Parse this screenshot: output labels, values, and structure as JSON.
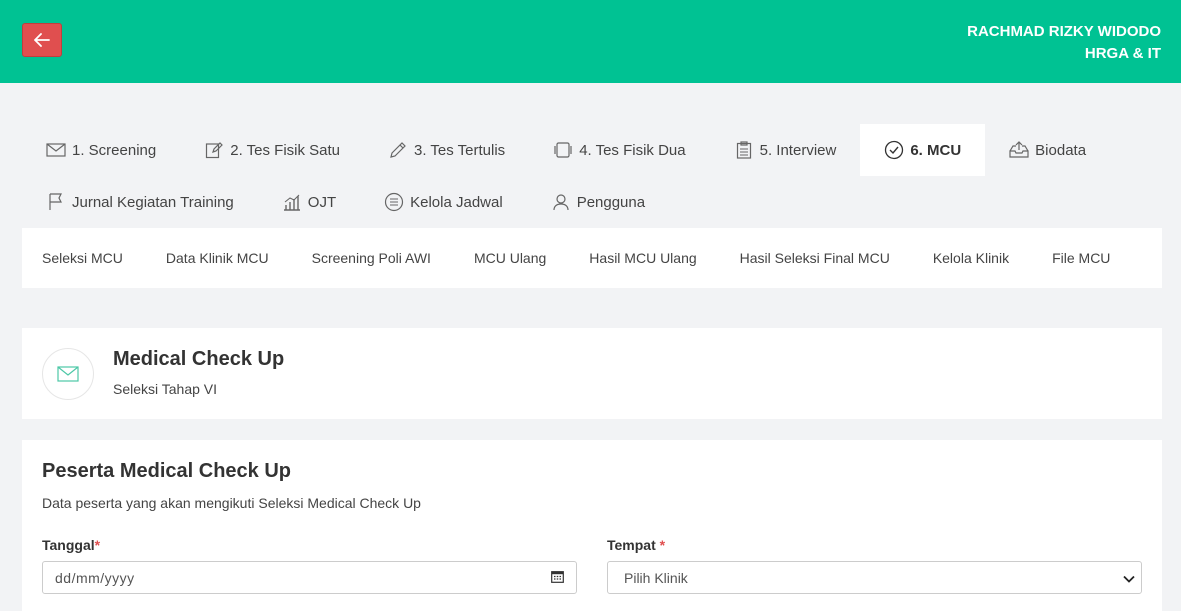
{
  "header": {
    "user_name": "RACHMAD RIZKY WIDODO",
    "department": "HRGA & IT"
  },
  "nav": {
    "row1": [
      {
        "label": "1. Screening",
        "icon": "envelope-icon"
      },
      {
        "label": "2. Tes Fisik Satu",
        "icon": "edit-icon"
      },
      {
        "label": "3. Tes Tertulis",
        "icon": "pencil-icon"
      },
      {
        "label": "4. Tes Fisik Dua",
        "icon": "tablet-icon"
      },
      {
        "label": "5. Interview",
        "icon": "clipboard-icon"
      },
      {
        "label": "6. MCU",
        "icon": "check-circle-icon",
        "active": true
      },
      {
        "label": "Biodata",
        "icon": "inbox-upload-icon"
      }
    ],
    "row2": [
      {
        "label": "Jurnal Kegiatan Training",
        "icon": "flag-icon"
      },
      {
        "label": "OJT",
        "icon": "bar-chart-icon"
      },
      {
        "label": "Kelola Jadwal",
        "icon": "list-circle-icon"
      },
      {
        "label": "Pengguna",
        "icon": "user-icon"
      }
    ]
  },
  "subnav": [
    "Seleksi MCU",
    "Data Klinik MCU",
    "Screening Poli AWI",
    "MCU Ulang",
    "Hasil MCU Ulang",
    "Hasil Seleksi Final MCU",
    "Kelola Klinik",
    "File MCU"
  ],
  "page_header": {
    "title": "Medical Check Up",
    "subtitle": "Seleksi Tahap VI",
    "icon": "envelope-icon"
  },
  "form": {
    "title": "Peserta Medical Check Up",
    "description": "Data peserta yang akan mengikuti Seleksi Medical Check Up",
    "tanggal_label": "Tanggal",
    "tanggal_placeholder": "dd/mm/yyyy",
    "tempat_label": "Tempat",
    "required_mark": "*",
    "tempat_selected": "Pilih Klinik"
  },
  "colors": {
    "topbar": "#00c293",
    "back_button": "#e04f4f"
  }
}
